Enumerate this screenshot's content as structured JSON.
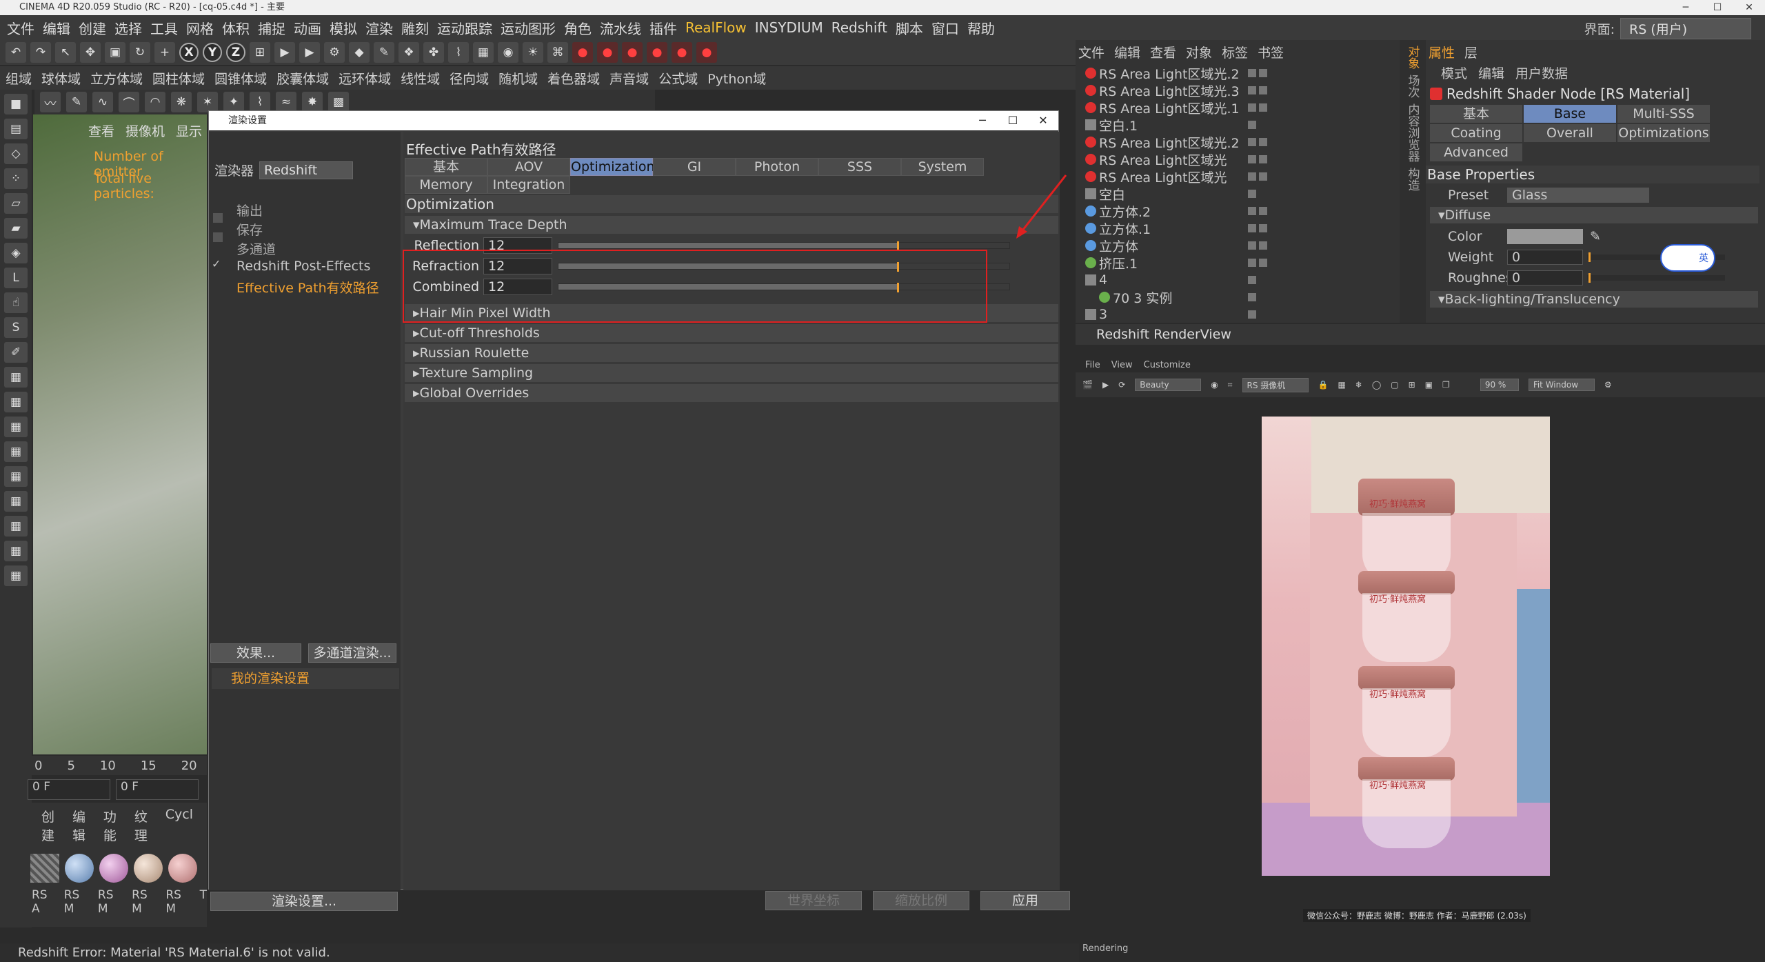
{
  "app": {
    "title": "CINEMA 4D R20.059 Studio (RC - R20) - [cq-05.c4d *] - 主要",
    "interface_label": "界面:",
    "interface_value": "RS (用户)"
  },
  "menu": [
    "文件",
    "编辑",
    "创建",
    "选择",
    "工具",
    "网格",
    "体积",
    "捕捉",
    "动画",
    "模拟",
    "渲染",
    "雕刻",
    "运动跟踪",
    "运动图形",
    "角色",
    "流水线",
    "插件",
    "RealFlow",
    "INSYDIUM",
    "Redshift",
    "脚本",
    "窗口",
    "帮助"
  ],
  "fields_bar": [
    "组域",
    "球体域",
    "立方体域",
    "圆柱体域",
    "圆锥体域",
    "胶囊体域",
    "远环体域",
    "线性域",
    "径向域",
    "随机域",
    "着色器域",
    "声音域",
    "公式域",
    "Python域"
  ],
  "viewport": {
    "menu": [
      "查看",
      "摄像机",
      "显示"
    ],
    "text1": "Number of emitter",
    "text2": "Total live particles:"
  },
  "timeline": {
    "ticks": [
      "0",
      "5",
      "10",
      "15",
      "20"
    ],
    "frame1": "0 F",
    "frame2": "0 F"
  },
  "materials": {
    "menu": [
      "创建",
      "编辑",
      "功能",
      "纹理",
      "Cycl"
    ],
    "labels": [
      "RS A",
      "RS M",
      "RS M",
      "RS M",
      "RS M",
      "T"
    ]
  },
  "status_bar": "Redshift Error: Material 'RS Material.6' is not valid.",
  "dialog": {
    "title": "渲染设置",
    "renderer_label": "渲染器",
    "renderer_value": "Redshift",
    "left_items": [
      "输出",
      "保存",
      "多通道",
      "Redshift Post-Effects",
      "Effective Path有效路径"
    ],
    "effect_btn": "效果...",
    "multipass_btn": "多通道渲染...",
    "my_settings": "我的渲染设置",
    "render_settings_btn": "渲染设置...",
    "section_title": "Effective Path有效路径",
    "tabs": [
      "基本",
      "AOV",
      "Optimization",
      "GI",
      "Photon",
      "SSS",
      "System",
      "Memory",
      "Integration"
    ],
    "active_tab": "Optimization",
    "opt_header": "Optimization",
    "max_trace": "Maximum Trace Depth",
    "params": [
      {
        "label": "Reflection",
        "value": "12",
        "fraction": 0.75
      },
      {
        "label": "Refraction",
        "value": "12",
        "fraction": 0.75
      },
      {
        "label": "Combined",
        "value": "12",
        "fraction": 0.75
      }
    ],
    "groups": [
      "Hair Min Pixel Width",
      "Cut-off Thresholds",
      "Russian Roulette",
      "Texture Sampling",
      "Global Overrides"
    ]
  },
  "bottom_controls": {
    "world": "世界坐标",
    "scale": "缩放比例",
    "apply": "应用"
  },
  "objects": {
    "menu": [
      "文件",
      "编辑",
      "查看",
      "对象",
      "标签",
      "书签"
    ],
    "rows": [
      "RS Area Light区域光.2",
      "RS Area Light区域光.3",
      "RS Area Light区域光.1",
      "空白.1",
      "RS Area Light区域光.2",
      "RS Area Light区域光",
      "RS Area Light区域光",
      "空白",
      "立方体.2",
      "立方体.1",
      "立方体",
      "挤压.1",
      "4",
      "70 3 实例",
      "3"
    ]
  },
  "side_tabs": [
    "对象",
    "场次",
    "内容浏览器",
    "构造"
  ],
  "attributes": {
    "tabs": [
      "属性",
      "层"
    ],
    "menu": [
      "模式",
      "编辑",
      "用户数据"
    ],
    "node": "Redshift Shader Node [RS Material]",
    "subtabs": [
      "基本",
      "Base Properties",
      "Multi-SSS",
      "Coating",
      "Overall",
      "Optimizations",
      "Advanced"
    ],
    "active_subtab": "Base Properties",
    "base_title": "Base Properties",
    "preset_label": "Preset",
    "preset_value": "Glass",
    "diffuse": "Diffuse",
    "color_label": "Color",
    "weight_label": "Weight",
    "weight_value": "0",
    "rough_label": "Roughness",
    "rough_value": "0",
    "backlight": "Back-lighting/Translucency",
    "badge": "英"
  },
  "renderview": {
    "title": "Redshift RenderView",
    "menu": [
      "File",
      "View",
      "Customize"
    ],
    "aov": "Beauty",
    "camera": "RS 摄像机",
    "zoom": "90 %",
    "fit": "Fit Window",
    "caption": "微信公众号：野鹿志  微博：野鹿志  作者：马鹿野郎  (2.03s)",
    "status": "Rendering",
    "jar_text": "初巧·鲜炖燕窝"
  },
  "colors": {
    "accent": "#f0a030",
    "active_tab": "#6e8bbf",
    "highlight_box": "#e02020"
  }
}
